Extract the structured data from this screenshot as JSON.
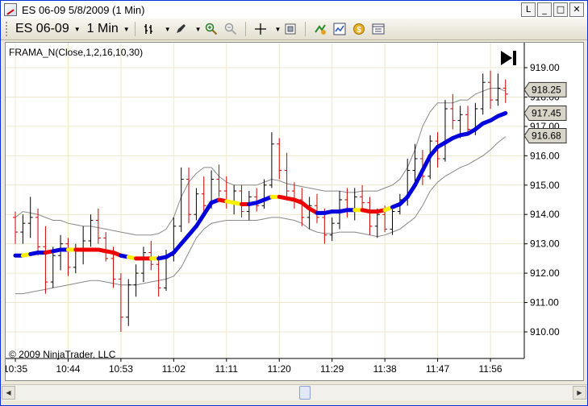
{
  "window": {
    "title": "ES 06-09  5/8/2009 (1 Min)",
    "buttons": [
      "L",
      "_",
      "□",
      "✕"
    ]
  },
  "toolbar": {
    "instrument": "ES 06-09",
    "interval": "1 Min"
  },
  "chart": {
    "indicator_label": "FRAMA_N(Close,1,2,16,10,30)",
    "copyright": "© 2009 NinjaTrader, LLC",
    "price_markers": [
      {
        "value": "918.25",
        "price": 918.25
      },
      {
        "value": "917.45",
        "price": 917.45
      },
      {
        "value": "916.68",
        "price": 916.68
      }
    ]
  },
  "chart_data": {
    "type": "ohlc",
    "x_ticks": [
      "10:35",
      "10:44",
      "10:53",
      "11:02",
      "11:11",
      "11:20",
      "11:29",
      "11:38",
      "11:47",
      "11:56"
    ],
    "y_ticks": [
      "919.00",
      "918.00",
      "917.00",
      "916.00",
      "915.00",
      "914.00",
      "913.00",
      "912.00",
      "911.00",
      "910.00"
    ],
    "ylim": [
      909.5,
      919.5
    ],
    "grid": true,
    "colors": {
      "frama_up": "#0000dd",
      "frama_down": "#ee0000",
      "frama_flat": "#ffee00",
      "bands": "#888888",
      "bar_up": "#000000",
      "bar_down": "#cc0000"
    },
    "bars": [
      [
        913.9,
        914.1,
        913.0,
        913.4
      ],
      [
        913.4,
        914.0,
        913.0,
        913.7
      ],
      [
        913.7,
        914.6,
        913.2,
        913.9
      ],
      [
        913.9,
        914.2,
        912.6,
        912.9
      ],
      [
        912.9,
        913.6,
        911.3,
        911.7
      ],
      [
        911.7,
        912.9,
        911.5,
        912.6
      ],
      [
        912.6,
        913.3,
        912.1,
        913.0
      ],
      [
        913.0,
        913.2,
        911.9,
        912.2
      ],
      [
        912.2,
        913.0,
        912.0,
        912.8
      ],
      [
        912.8,
        913.6,
        912.3,
        913.1
      ],
      [
        913.1,
        914.0,
        912.9,
        913.8
      ],
      [
        913.8,
        914.2,
        913.0,
        913.2
      ],
      [
        913.2,
        913.4,
        912.4,
        912.5
      ],
      [
        912.5,
        912.9,
        911.5,
        911.8
      ],
      [
        911.8,
        912.0,
        910.0,
        910.5
      ],
      [
        910.5,
        911.8,
        910.2,
        911.6
      ],
      [
        911.6,
        912.3,
        911.2,
        912.0
      ],
      [
        912.0,
        912.9,
        911.7,
        912.7
      ],
      [
        912.7,
        913.1,
        912.1,
        912.3
      ],
      [
        912.3,
        912.6,
        911.2,
        911.5
      ],
      [
        911.5,
        912.8,
        911.4,
        912.6
      ],
      [
        912.6,
        913.9,
        912.4,
        913.6
      ],
      [
        913.6,
        915.6,
        913.4,
        915.2
      ],
      [
        915.2,
        915.6,
        913.7,
        914.0
      ],
      [
        914.0,
        914.9,
        913.8,
        914.7
      ],
      [
        914.7,
        915.3,
        914.1,
        914.3
      ],
      [
        914.3,
        915.5,
        914.2,
        915.2
      ],
      [
        915.2,
        915.7,
        914.6,
        914.8
      ],
      [
        914.8,
        915.3,
        914.2,
        914.4
      ],
      [
        914.4,
        915.0,
        914.0,
        914.8
      ],
      [
        914.8,
        915.0,
        913.9,
        914.1
      ],
      [
        914.1,
        914.8,
        913.8,
        914.6
      ],
      [
        914.6,
        914.9,
        914.1,
        914.3
      ],
      [
        914.3,
        915.2,
        914.2,
        915.0
      ],
      [
        915.0,
        916.8,
        914.9,
        916.4
      ],
      [
        916.4,
        916.6,
        915.2,
        915.5
      ],
      [
        915.5,
        916.1,
        914.6,
        914.8
      ],
      [
        914.8,
        915.1,
        914.2,
        914.5
      ],
      [
        914.5,
        914.9,
        913.6,
        913.9
      ],
      [
        913.9,
        914.6,
        913.5,
        914.3
      ],
      [
        914.3,
        914.7,
        913.7,
        913.9
      ],
      [
        913.9,
        914.2,
        913.0,
        913.3
      ],
      [
        913.3,
        913.9,
        913.1,
        913.7
      ],
      [
        913.7,
        914.8,
        913.5,
        914.5
      ],
      [
        914.5,
        914.9,
        913.9,
        914.1
      ],
      [
        914.1,
        914.9,
        913.8,
        914.6
      ],
      [
        914.6,
        915.0,
        914.2,
        914.4
      ],
      [
        914.4,
        914.6,
        913.3,
        913.6
      ],
      [
        913.6,
        914.2,
        913.2,
        914.0
      ],
      [
        914.0,
        914.3,
        913.4,
        913.5
      ],
      [
        913.5,
        914.2,
        913.3,
        914.1
      ],
      [
        914.1,
        914.7,
        914.0,
        914.5
      ],
      [
        914.5,
        915.9,
        914.3,
        915.5
      ],
      [
        915.5,
        916.4,
        915.1,
        915.9
      ],
      [
        915.9,
        916.2,
        915.0,
        915.3
      ],
      [
        915.3,
        916.7,
        915.2,
        916.5
      ],
      [
        916.5,
        916.8,
        915.6,
        915.9
      ],
      [
        915.9,
        917.9,
        915.8,
        917.6
      ],
      [
        917.6,
        918.1,
        916.9,
        917.2
      ],
      [
        917.2,
        917.7,
        916.6,
        917.4
      ],
      [
        917.4,
        917.7,
        916.8,
        916.9
      ],
      [
        916.9,
        917.8,
        916.7,
        917.6
      ],
      [
        917.6,
        918.8,
        917.4,
        918.5
      ],
      [
        918.5,
        918.9,
        917.6,
        917.9
      ],
      [
        917.9,
        918.8,
        917.7,
        918.3
      ],
      [
        918.3,
        918.6,
        917.8,
        918.1
      ]
    ],
    "frama": [
      912.6,
      912.6,
      912.65,
      912.7,
      912.7,
      912.75,
      912.8,
      912.8,
      912.8,
      912.8,
      912.8,
      912.8,
      912.75,
      912.7,
      912.6,
      912.55,
      912.5,
      912.5,
      912.5,
      912.5,
      912.55,
      912.7,
      913.0,
      913.3,
      913.6,
      914.0,
      914.4,
      914.5,
      914.45,
      914.4,
      914.35,
      914.35,
      914.4,
      914.5,
      914.6,
      914.6,
      914.55,
      914.5,
      914.4,
      914.2,
      914.05,
      914.05,
      914.1,
      914.1,
      914.15,
      914.15,
      914.15,
      914.1,
      914.1,
      914.15,
      914.25,
      914.35,
      914.6,
      915.0,
      915.5,
      916.0,
      916.3,
      916.45,
      916.6,
      916.7,
      916.75,
      916.9,
      917.1,
      917.2,
      917.35,
      917.45
    ],
    "frama_state": [
      "u",
      "f",
      "u",
      "u",
      "d",
      "u",
      "u",
      "f",
      "d",
      "d",
      "d",
      "d",
      "d",
      "d",
      "u",
      "f",
      "d",
      "d",
      "f",
      "u",
      "u",
      "u",
      "u",
      "u",
      "u",
      "u",
      "u",
      "d",
      "f",
      "f",
      "d",
      "u",
      "u",
      "u",
      "f",
      "d",
      "d",
      "d",
      "d",
      "d",
      "u",
      "u",
      "u",
      "u",
      "u",
      "f",
      "d",
      "d",
      "d",
      "f",
      "u",
      "u",
      "u",
      "u",
      "u",
      "u",
      "u",
      "u",
      "u",
      "u",
      "u",
      "u",
      "u",
      "u",
      "u",
      "u"
    ],
    "upper_band": [
      913.9,
      914.1,
      914.05,
      914.0,
      913.9,
      913.8,
      913.8,
      913.7,
      913.65,
      913.6,
      913.6,
      913.55,
      913.5,
      913.45,
      913.4,
      913.35,
      913.3,
      913.3,
      913.3,
      913.35,
      913.5,
      913.9,
      914.6,
      915.1,
      915.4,
      915.6,
      915.6,
      915.3,
      915.1,
      915.0,
      915.0,
      915.0,
      915.0,
      915.1,
      915.2,
      915.15,
      915.05,
      915.0,
      914.95,
      914.9,
      914.85,
      914.8,
      914.8,
      914.8,
      914.75,
      914.75,
      914.8,
      914.8,
      914.8,
      914.9,
      915.0,
      915.2,
      915.6,
      916.2,
      917.0,
      917.5,
      917.8,
      917.8,
      917.8,
      917.9,
      917.9,
      918.1,
      918.2,
      918.3,
      918.3,
      918.2
    ],
    "lower_band": [
      911.3,
      911.3,
      911.35,
      911.4,
      911.45,
      911.5,
      911.55,
      911.6,
      911.65,
      911.7,
      911.75,
      911.75,
      911.7,
      911.65,
      911.6,
      911.6,
      911.6,
      911.65,
      911.7,
      911.75,
      911.8,
      911.9,
      912.2,
      912.7,
      913.2,
      913.5,
      913.7,
      913.75,
      913.8,
      913.8,
      913.8,
      913.8,
      913.8,
      913.85,
      913.9,
      913.9,
      913.85,
      913.8,
      913.7,
      913.5,
      913.4,
      913.35,
      913.35,
      913.4,
      913.4,
      913.4,
      913.35,
      913.3,
      913.25,
      913.3,
      913.4,
      913.5,
      913.7,
      913.9,
      914.3,
      914.8,
      915.1,
      915.3,
      915.45,
      915.6,
      915.7,
      915.85,
      916.0,
      916.2,
      916.45,
      916.65
    ]
  }
}
